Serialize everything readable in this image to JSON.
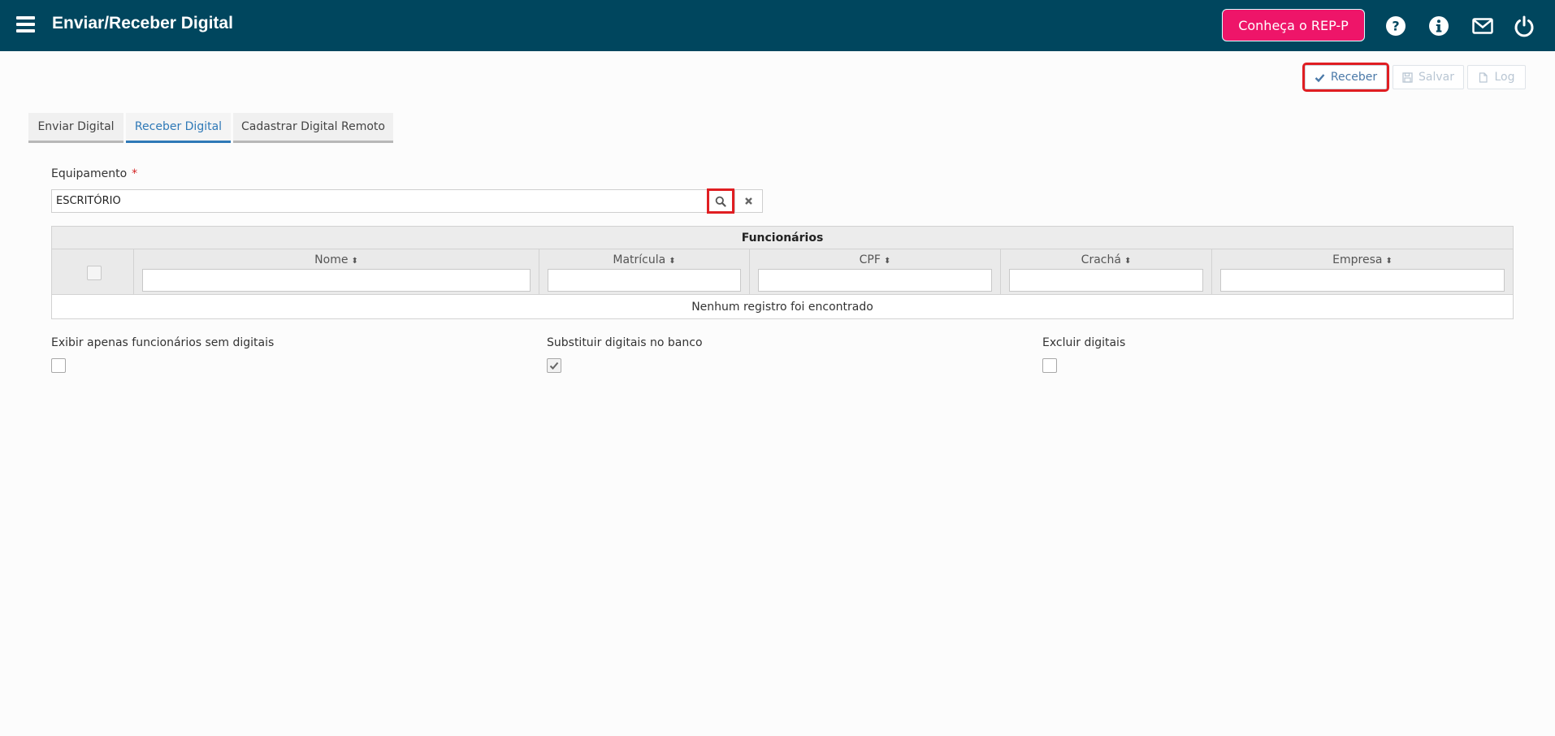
{
  "header": {
    "title": "Enviar/Receber Digital",
    "promo_label": "Conheça o REP-P",
    "icons": [
      "help-icon",
      "info-icon",
      "mail-icon",
      "power-icon"
    ]
  },
  "toolbar": {
    "receive_label": "Receber",
    "save_label": "Salvar",
    "log_label": "Log"
  },
  "tabs": [
    {
      "label": "Enviar Digital",
      "active": false
    },
    {
      "label": "Receber Digital",
      "active": true
    },
    {
      "label": "Cadastrar Digital Remoto",
      "active": false
    }
  ],
  "form": {
    "equipment_label": "Equipamento",
    "required_mark": "*",
    "equipment_value": "ESCRITÓRIO"
  },
  "table": {
    "caption": "Funcionários",
    "columns": [
      "Nome",
      "Matrícula",
      "CPF",
      "Crachá",
      "Empresa"
    ],
    "empty_message": "Nenhum registro foi encontrado"
  },
  "options": [
    {
      "label": "Exibir apenas funcionários sem digitais",
      "checked": false
    },
    {
      "label": "Substituir digitais no banco",
      "checked": true
    },
    {
      "label": "Excluir digitais",
      "checked": false
    }
  ],
  "colors": {
    "header_bg": "#00465e",
    "promo_bg": "#ee1569",
    "accent": "#2f79b7",
    "highlight": "#e01e22"
  }
}
